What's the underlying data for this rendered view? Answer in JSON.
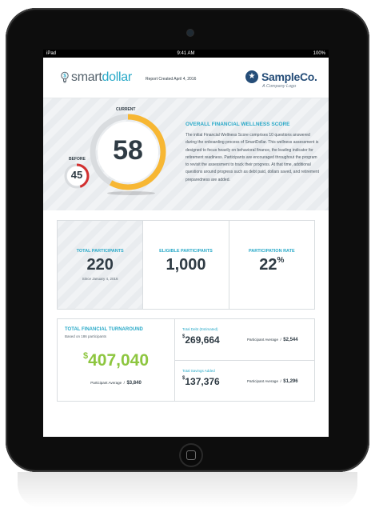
{
  "status": {
    "carrier": "iPad",
    "time": "9:41 AM",
    "battery": "100%"
  },
  "header": {
    "logo_word_1": "smart",
    "logo_word_2": "dollar",
    "report_date": "Report Created April 4, 2016",
    "brand_name": "SampleCo.",
    "brand_tagline": "A Company Logo"
  },
  "score": {
    "current_label": "CURRENT",
    "current_value": "58",
    "current_fraction": 0.58,
    "before_label": "BEFORE",
    "before_value": "45",
    "before_fraction": 0.45,
    "title": "OVERALL FINANCIAL WELLNESS SCORE",
    "description": "The initial Financial Wellness Score comprises 10 questions answered during the onboarding process of SmartDollar. This wellness assessment is designed to focus heavily on behavioral finance, the leading indicator for retirement readiness. Participants are encouraged throughout the program to revisit the assessment to track their progress. At that time, additional questions around progress such as debt paid, dollars saved, and retirement preparedness are added."
  },
  "stats": {
    "total_label": "TOTAL PARTICIPANTS",
    "total_value": "220",
    "total_sub": "Since January 4, 2016",
    "eligible_label": "ELIGIBLE PARTICIPANTS",
    "eligible_value": "1,000",
    "rate_label": "PARTICIPATION RATE",
    "rate_value": "22",
    "rate_unit": "%"
  },
  "turnaround": {
    "title": "TOTAL FINANCIAL TURNAROUND",
    "subtitle": "Based on 186 participants",
    "currency": "$",
    "value": "407,040",
    "avg_label": "Participant Average",
    "avg_sep": "/",
    "avg_value": "$3,840",
    "debt_label": "Total Debt (Estimated)",
    "debt_value": "269,664",
    "debt_avg_value": "$2,544",
    "savings_label": "Total Savings Added",
    "savings_value": "137,376",
    "savings_avg_value": "$1,296"
  },
  "colors": {
    "accent": "#29a9c8",
    "gauge_current": "#f7b733",
    "gauge_before": "#d32f2f",
    "money": "#8dc63f",
    "brand": "#254d78",
    "text": "#2f3b44"
  }
}
